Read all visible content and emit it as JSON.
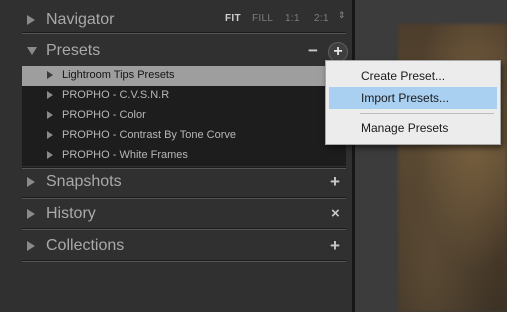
{
  "navigator": {
    "title": "Navigator",
    "zoom": [
      "FIT",
      "FILL",
      "1:1",
      "2:1"
    ],
    "updown": "⇕"
  },
  "presets": {
    "title": "Presets",
    "remove_symbol": "−",
    "add_symbol": "+",
    "items": [
      "Lightroom Tips Presets",
      "PROPHO - C.V.S.N.R",
      "PROPHO - Color",
      "PROPHO - Contrast By Tone Corve",
      "PROPHO - White Frames"
    ]
  },
  "menu": {
    "items": [
      "Create Preset...",
      "Import Presets...",
      "Manage Presets"
    ]
  },
  "snapshots": {
    "title": "Snapshots",
    "add_symbol": "+"
  },
  "history": {
    "title": "History",
    "clear_symbol": "×"
  },
  "collections": {
    "title": "Collections",
    "add_symbol": "+"
  }
}
